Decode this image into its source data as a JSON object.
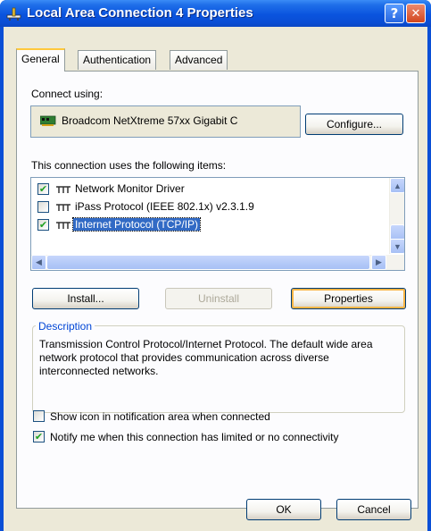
{
  "window": {
    "title": "Local Area Connection 4 Properties",
    "help_glyph": "?",
    "close_glyph": "✕"
  },
  "tabs": [
    {
      "label": "General",
      "active": true
    },
    {
      "label": "Authentication",
      "active": false
    },
    {
      "label": "Advanced",
      "active": false
    }
  ],
  "connect_using": {
    "label": "Connect using:",
    "device": "Broadcom NetXtreme 57xx Gigabit C",
    "configure_label": "Configure..."
  },
  "items_section": {
    "label": "This connection uses the following items:",
    "items": [
      {
        "label": "Network Monitor Driver",
        "checked": true,
        "check_glyph": "✔"
      },
      {
        "label": "iPass Protocol (IEEE 802.1x) v2.3.1.9",
        "checked": false,
        "check_glyph": ""
      },
      {
        "label": "Internet Protocol (TCP/IP)",
        "checked": true,
        "check_glyph": "✔",
        "selected": true
      }
    ]
  },
  "buttons": {
    "install": "Install...",
    "uninstall": "Uninstall",
    "properties": "Properties",
    "ok": "OK",
    "cancel": "Cancel"
  },
  "description": {
    "title": "Description",
    "text": "Transmission Control Protocol/Internet Protocol. The default wide area network protocol that provides communication across diverse interconnected networks."
  },
  "options": {
    "show_icon": {
      "label": "Show icon in notification area when connected",
      "checked": false,
      "check_glyph": ""
    },
    "notify": {
      "label": "Notify me when this connection has limited or no connectivity",
      "checked": true,
      "check_glyph": "✔"
    }
  },
  "scroll_glyphs": {
    "up": "▲",
    "down": "▼",
    "left": "◀",
    "right": "▶"
  },
  "colors": {
    "titlebar": "#0a54de",
    "face": "#ece9d8",
    "selection": "#316ac5",
    "group_title": "#0046d5"
  }
}
